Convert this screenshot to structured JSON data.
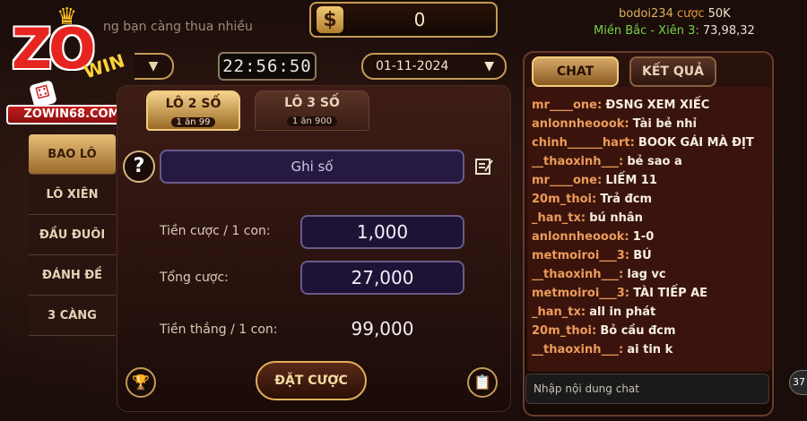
{
  "header": {
    "ticker_text": "ng bạn càng thua nhiều",
    "balance_symbol": "$",
    "balance": "0",
    "user_line": {
      "name": "bodoi234",
      "action": "cược",
      "amount": "50K"
    },
    "result_line": {
      "label": "Miền Bắc - Xiên 3:",
      "numbers": "73,98,32"
    }
  },
  "logo": {
    "brand": "ZO",
    "sub": "WIN",
    "site": "ZOWIN68.COM"
  },
  "controls": {
    "clock": "22:56:50",
    "date": "01-11-2024"
  },
  "tabs": [
    {
      "label": "LÔ 2 SỐ",
      "odds": "1 ăn 99",
      "active": true
    },
    {
      "label": "LÔ 3 SỐ",
      "odds": "1 ăn 900",
      "active": false
    }
  ],
  "sidebar": {
    "items": [
      {
        "label": "BAO LÔ",
        "active": true
      },
      {
        "label": "LÔ XIÊN",
        "active": false
      },
      {
        "label": "ĐẦU ĐUÔI",
        "active": false
      },
      {
        "label": "ĐÁNH ĐỀ",
        "active": false
      },
      {
        "label": "3 CÀNG",
        "active": false
      }
    ]
  },
  "form": {
    "help": "?",
    "ghi_so": "Ghi số",
    "stake_label": "Tiền cược / 1 con:",
    "stake_value": "1,000",
    "total_label": "Tổng cược:",
    "total_value": "27,000",
    "win_label": "Tiền thắng / 1 con:",
    "win_value": "99,000",
    "bet_button": "ĐẶT CƯỢC"
  },
  "chat": {
    "tab_chat": "CHAT",
    "tab_result": "KẾT QUẢ",
    "messages": [
      {
        "user": "mr____one:",
        "text": "ĐSNG XEM XIẾC"
      },
      {
        "user": "anlonnheoook:",
        "text": "Tài bẻ nhỉ"
      },
      {
        "user": "chinh______hart:",
        "text": "BOOK GÁI MÀ ĐỊT"
      },
      {
        "user": "__thaoxinh___:",
        "text": "bẻ sao a"
      },
      {
        "user": "mr____one:",
        "text": "LIẾM 11"
      },
      {
        "user": "20m_thoi:",
        "text": "Trả đcm"
      },
      {
        "user": "_han_tx:",
        "text": "bú nhân"
      },
      {
        "user": "anlonnheoook:",
        "text": "1-0"
      },
      {
        "user": "metmoiroi___3:",
        "text": "BÚ"
      },
      {
        "user": "__thaoxinh___:",
        "text": "lag vc"
      },
      {
        "user": "metmoiroi___3:",
        "text": "TÀI TIẾP AE"
      },
      {
        "user": "_han_tx:",
        "text": "all in phát"
      },
      {
        "user": "20m_thoi:",
        "text": "Bỏ cầu đcm"
      },
      {
        "user": "__thaoxinh___:",
        "text": "ai tin k"
      }
    ],
    "input_placeholder": "Nhập nội dung chat",
    "badge": "37"
  }
}
